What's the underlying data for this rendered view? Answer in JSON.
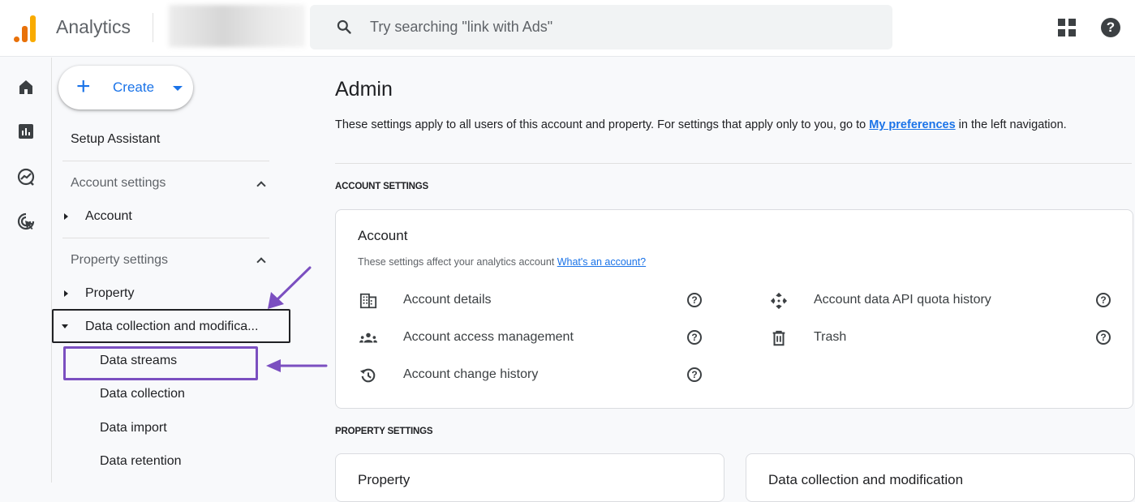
{
  "app": {
    "title": "Analytics"
  },
  "search": {
    "placeholder": "Try searching \"link with Ads\""
  },
  "topbar_icons": {
    "apps": "apps-grid-icon",
    "help": "help-icon",
    "help_glyph": "?"
  },
  "rail": [
    {
      "icon": "home-icon",
      "label": "Home"
    },
    {
      "icon": "reports-icon",
      "label": "Reports"
    },
    {
      "icon": "explore-icon",
      "label": "Explore"
    },
    {
      "icon": "advertising-icon",
      "label": "Advertising"
    }
  ],
  "nav": {
    "create_label": "Create",
    "create_plus": "+",
    "setup_assistant": "Setup Assistant",
    "account_settings": "Account settings",
    "account": "Account",
    "property_settings": "Property settings",
    "property": "Property",
    "data_collection_group": "Data collection and modifica...",
    "sub_items": [
      "Data streams",
      "Data collection",
      "Data import",
      "Data retention"
    ],
    "highlighted_item": "Data streams"
  },
  "main": {
    "title": "Admin",
    "desc_prefix": "These settings apply to all users of this account and property. For settings that apply only to you, go to ",
    "desc_link": "My preferences",
    "desc_suffix": " in the left navigation.",
    "account_section_label": "ACCOUNT SETTINGS",
    "property_section_label": "PROPERTY SETTINGS",
    "account_card": {
      "title": "Account",
      "subtitle": "These settings affect your analytics account ",
      "subtitle_link": "What's an account?",
      "left_items": [
        {
          "label": "Account details",
          "icon": "building-icon"
        },
        {
          "label": "Account access management",
          "icon": "people-icon"
        },
        {
          "label": "Account change history",
          "icon": "history-icon"
        }
      ],
      "right_items": [
        {
          "label": "Account data API quota history",
          "icon": "api-quota-icon"
        },
        {
          "label": "Trash",
          "icon": "trash-icon"
        }
      ],
      "help_glyph": "?"
    },
    "property_card": {
      "title": "Property"
    },
    "data_collection_card": {
      "title": "Data collection and modification"
    }
  },
  "annotations": {
    "color": "#7b4fc0"
  }
}
